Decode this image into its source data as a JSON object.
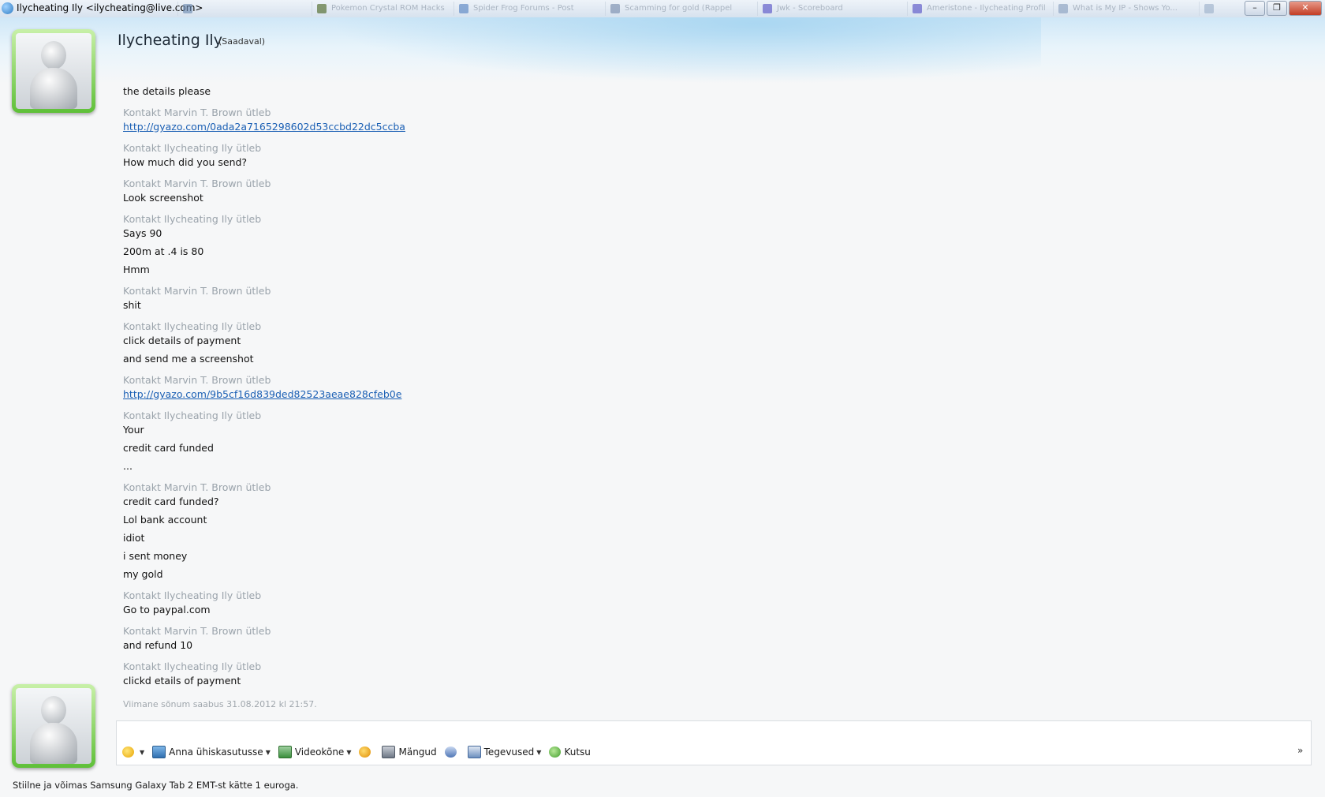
{
  "window": {
    "title": "Ilycheating Ily <ilycheating@live.com>",
    "taskbar_tabs": [
      {
        "label": "",
        "color": "#6f8db3"
      },
      {
        "label": "Pokemon Crystal ROM Hacks",
        "color": "#4f6a2a"
      },
      {
        "label": "Spider Frog Forums - Post",
        "color": "#5a86c4"
      },
      {
        "label": "Scamming for gold (Rappel",
        "color": "#7a8fb0"
      },
      {
        "label": "Jwk - Scoreboard",
        "color": "#5a56c8"
      },
      {
        "label": "Ameristone - Ilycheating Profil",
        "color": "#5a56c8"
      },
      {
        "label": "What is My IP - Shows Yo...",
        "color": "#8aa1c0"
      },
      {
        "label": "",
        "color": "#9fb3cc"
      }
    ],
    "controls": {
      "minimize": "–",
      "maximize": "❐",
      "close": "✕"
    }
  },
  "contact": {
    "name": "Ilycheating Ily",
    "status": "(Saadaval)"
  },
  "conversation": [
    {
      "type": "msg",
      "text": "the details please"
    },
    {
      "type": "speaker",
      "text": "Kontakt Marvin T. Brown ütleb"
    },
    {
      "type": "link",
      "text": "http://gyazo.com/0ada2a7165298602d53ccbd22dc5ccba"
    },
    {
      "type": "speaker",
      "text": "Kontakt Ilycheating Ily ütleb"
    },
    {
      "type": "msg",
      "text": "How much did you send?"
    },
    {
      "type": "speaker",
      "text": "Kontakt Marvin T. Brown ütleb"
    },
    {
      "type": "msg",
      "text": "Look screenshot"
    },
    {
      "type": "speaker",
      "text": "Kontakt Ilycheating Ily ütleb"
    },
    {
      "type": "msg",
      "text": "Says 90"
    },
    {
      "type": "msg",
      "text": "200m at .4 is 80"
    },
    {
      "type": "msg",
      "text": "Hmm"
    },
    {
      "type": "speaker",
      "text": "Kontakt Marvin T. Brown ütleb"
    },
    {
      "type": "msg",
      "text": "shit"
    },
    {
      "type": "speaker",
      "text": "Kontakt Ilycheating Ily ütleb"
    },
    {
      "type": "msg",
      "text": "click details of payment"
    },
    {
      "type": "msg",
      "text": "and send me a screenshot"
    },
    {
      "type": "speaker",
      "text": "Kontakt Marvin T. Brown ütleb"
    },
    {
      "type": "link",
      "text": "http://gyazo.com/9b5cf16d839ded82523aeae828cfeb0e"
    },
    {
      "type": "speaker",
      "text": "Kontakt Ilycheating Ily ütleb"
    },
    {
      "type": "msg",
      "text": "Your"
    },
    {
      "type": "msg",
      "text": "credit card funded"
    },
    {
      "type": "msg",
      "text": "..."
    },
    {
      "type": "speaker",
      "text": "Kontakt Marvin T. Brown ütleb"
    },
    {
      "type": "msg",
      "text": "credit card funded?"
    },
    {
      "type": "msg",
      "text": "Lol bank account"
    },
    {
      "type": "msg",
      "text": "idiot"
    },
    {
      "type": "msg",
      "text": "i sent money"
    },
    {
      "type": "msg",
      "text": "my gold"
    },
    {
      "type": "speaker",
      "text": "Kontakt Ilycheating Ily ütleb"
    },
    {
      "type": "msg",
      "text": "Go to paypal.com"
    },
    {
      "type": "speaker",
      "text": "Kontakt Marvin T. Brown ütleb"
    },
    {
      "type": "msg",
      "text": "and refund 10"
    },
    {
      "type": "speaker",
      "text": "Kontakt Ilycheating Ily ütleb"
    },
    {
      "type": "msg",
      "text": "clickd etails of payment"
    }
  ],
  "last_message_info": "Viimane sõnum saabus 31.08.2012 kl 21:57.",
  "input": {
    "value": "",
    "placeholder": ""
  },
  "toolbar": {
    "emoticon_icon": "emoticon-icon",
    "share": "Anna ühiskasutusse",
    "video_call": "Videokõne",
    "nudge_icon": "nudge-icon",
    "games": "Mängud",
    "wink_icon": "wink-icon",
    "activities": "Tegevused",
    "invite": "Kutsu",
    "overflow": "»"
  },
  "ad_text": "Stiilne ja võimas Samsung Galaxy Tab 2 EMT-st kätte 1 euroga."
}
